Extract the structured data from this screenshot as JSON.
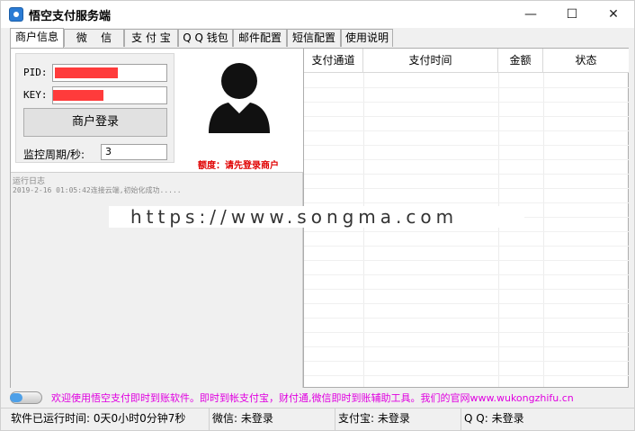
{
  "window": {
    "title": "悟空支付服务端",
    "minimize": "—",
    "maximize": "☐",
    "close": "✕"
  },
  "tabs": [
    {
      "label": "商户信息"
    },
    {
      "label": "微    信"
    },
    {
      "label": "支 付 宝"
    },
    {
      "label": "Q Q 钱包"
    },
    {
      "label": "邮件配置"
    },
    {
      "label": "短信配置"
    },
    {
      "label": "使用说明"
    }
  ],
  "merchant": {
    "pid_label": "PID:",
    "key_label": "KEY:",
    "login_button": "商户登录",
    "interval_label": "监控周期/秒:",
    "interval_value": "3",
    "balance": "额度：请先登录商户"
  },
  "log": {
    "title": "运行日志",
    "lines": [
      "2019-2-16 01:05:42连接云端,初始化成功....."
    ]
  },
  "grid": {
    "columns": [
      "支付通道",
      "支付时间",
      "金额",
      "状态"
    ]
  },
  "watermark": "https://www.songma.com",
  "marquee": "欢迎使用悟空支付即时到账软件。即时到帐支付宝，财付通,微信即时到账辅助工具。我们的官网www.wukongzhifu.cn",
  "status": {
    "runtime": "软件已运行时间:  0天0小时0分钟7秒",
    "wechat": "微信:  未登录",
    "alipay": "支付宝:  未登录",
    "qq": "Q Q:  未登录"
  },
  "colors": {
    "accent": "#2a7bd4",
    "redaction": "#ff3b3b",
    "balance_text": "#e00000",
    "marquee_text": "#e000e0"
  }
}
